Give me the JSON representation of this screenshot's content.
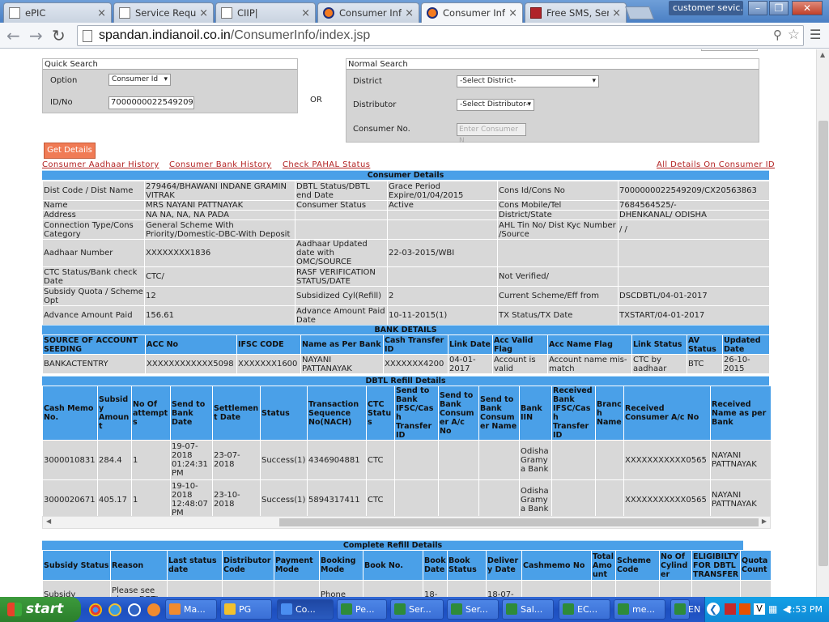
{
  "browser": {
    "tabs": [
      {
        "label": "ePIC",
        "icon": "document-icon"
      },
      {
        "label": "Service Reque",
        "icon": "document-icon"
      },
      {
        "label": "CIIP|",
        "icon": "document-icon"
      },
      {
        "label": "Consumer Info",
        "icon": "indianoil-icon"
      },
      {
        "label": "Consumer Info",
        "icon": "indianoil-icon"
      },
      {
        "label": "Free SMS, Sen",
        "icon": "mail-icon"
      }
    ],
    "user_button": "customer sevic...",
    "url_host": "spandan.indianoil.co.in",
    "url_path": "/ConsumerInfo/index.jsp"
  },
  "quick_search": {
    "title": "Quick Search",
    "option_label": "Option",
    "option_value": "Consumer Id",
    "id_label": "ID/No",
    "id_value": "7000000022549209"
  },
  "or_label": "OR",
  "normal_search": {
    "title": "Normal Search",
    "district_label": "District",
    "district_value": "-Select District-",
    "distributor_label": "Distributor",
    "distributor_value": "-Select Distributor-",
    "consumer_label": "Consumer No.",
    "consumer_placeholder": "Enter Consumer N"
  },
  "get_details": "Get Details",
  "links": [
    "Consumer Aadhaar History",
    "Consumer Bank History",
    "Check PAHAL Status",
    "All Details On Consumer ID"
  ],
  "consumer_details": {
    "title": "Consumer Details",
    "rows": [
      [
        "Dist Code / Dist Name",
        "279464/BHAWANI INDANE GRAMIN VITRAK",
        "DBTL Status/DBTL end Date",
        "Grace Period Expire/01/04/2015",
        "Cons Id/Cons No",
        "7000000022549209/CX20563863"
      ],
      [
        "Name",
        "MRS NAYANI PATTNAYAK",
        "Consumer Status",
        "Active",
        "Cons Mobile/Tel",
        "7684564525/-"
      ],
      [
        "Address",
        "NA NA, NA, NA PADA",
        "",
        "",
        "District/State",
        "DHENKANAL/ ODISHA"
      ],
      [
        "Connection Type/Cons Category",
        "General Scheme With Priority/Domestic-DBC-With Deposit",
        "",
        "",
        "AHL Tin No/ Dist Kyc Number /Source",
        "/ /"
      ],
      [
        "Aadhaar Number",
        "XXXXXXXX1836",
        "Aadhaar Updated date with OMC/SOURCE",
        "22-03-2015/WBI",
        "",
        ""
      ],
      [
        "CTC Status/Bank check Date",
        "CTC/",
        "RASF VERIFICATION STATUS/DATE",
        "",
        "Not Verified/",
        ""
      ],
      [
        "Subsidy Quota / Scheme Opt",
        "12",
        "Subsidized Cyl(Refill)",
        "2",
        "Current Scheme/Eff from",
        "DSCDBTL/04-01-2017"
      ],
      [
        "Advance Amount Paid",
        "156.61",
        "Advance Amount Paid Date",
        "10-11-2015(1)",
        "TX Status/TX Date",
        "TXSTART/04-01-2017"
      ]
    ]
  },
  "bank_details": {
    "title": "BANK DETAILS",
    "headers": [
      "SOURCE OF ACCOUNT SEEDING",
      "ACC No",
      "IFSC CODE",
      "Name as Per Bank",
      "Cash Transfer ID",
      "Link Date",
      "Acc Valid Flag",
      "Acc Name Flag",
      "Link Status",
      "AV Status",
      "Updated Date"
    ],
    "rows": [
      [
        "BANKACTENTRY",
        "XXXXXXXXXXXX5098",
        "XXXXXXX1600",
        "NAYANI PATTANAYAK",
        "XXXXXXX4200",
        "04-01-2017",
        "Account is valid",
        "Account name mis-match",
        "CTC by aadhaar",
        "BTC",
        "26-10-2015"
      ]
    ]
  },
  "dbtl_refill": {
    "title": "DBTL Refill Details",
    "headers": [
      "Cash Memo No.",
      "Subsidy Amount",
      "No Of attempts",
      "Send to Bank Date",
      "Settlement Date",
      "Status",
      "Transaction Sequence No(NACH)",
      "CTC Status",
      "Send to Bank IFSC/Cash Transfer ID",
      "Send to Bank Consumer A/c No",
      "Send to Bank Consumer Name",
      "Bank IIN",
      "Received Bank IFSC/Cash Transfer ID",
      "Branch Name",
      "Received Consumer A/c No",
      "Received Name as per Bank"
    ],
    "rows": [
      [
        "3000010831",
        "284.4",
        "1",
        "19-07-2018 01:24:31 PM",
        "23-07-2018",
        "Success(1)",
        "4346904881",
        "CTC",
        "",
        "",
        "",
        "Odisha Gramya Bank",
        "",
        "",
        "XXXXXXXXXXX0565",
        "NAYANI PATTNAYAK"
      ],
      [
        "3000020671",
        "405.17",
        "1",
        "19-10-2018 12:48:07 PM",
        "23-10-2018",
        "Success(1)",
        "5894317411",
        "CTC",
        "",
        "",
        "",
        "Odisha Gramya Bank",
        "",
        "",
        "XXXXXXXXXXX0565",
        "NAYANI PATTNAYAK"
      ]
    ]
  },
  "complete_refill": {
    "title": "Complete Refill Details",
    "headers": [
      "Subsidy Status",
      "Reason",
      "Last status date",
      "Distributor Code",
      "Payment Mode",
      "Booking Mode",
      "Book No.",
      "Book Date",
      "Book Status",
      "Delivery Date",
      "Cashmemo No",
      "Total Amount",
      "Scheme Code",
      "No Of Cylinder",
      "ELIGIBILTY FOR DBTL TRANSFER",
      "Quota Count"
    ],
    "rows": [
      [
        "Subsidy",
        "Please see above DBTL",
        "",
        "",
        "",
        "Phone",
        "",
        "18-",
        "",
        "18-07-",
        "",
        "",
        "",
        "",
        "",
        ""
      ]
    ]
  },
  "taskbar": {
    "start": "start",
    "tasks": [
      "Ma...",
      "PG",
      "Co...",
      "Pe...",
      "Ser...",
      "Ser...",
      "Sal...",
      "EC...",
      "me...",
      ""
    ],
    "lang": "EN",
    "time": "2:53 PM"
  },
  "colors": {
    "header_blue": "#4aa0e8",
    "link_red": "#b22222",
    "button_orange": "#f07b55",
    "taskbar_blue": "#245edb",
    "start_green": "#3c9a3c"
  }
}
